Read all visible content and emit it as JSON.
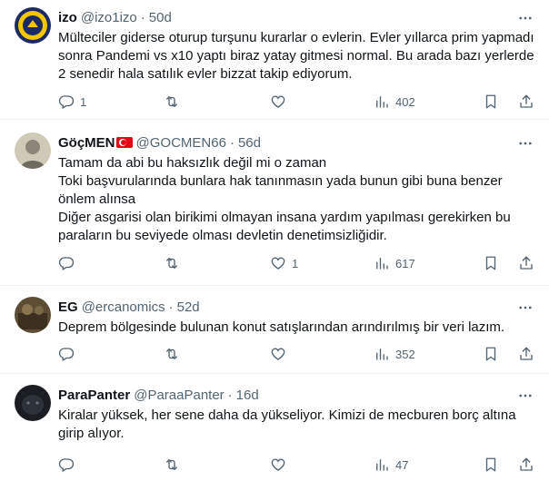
{
  "tweets": [
    {
      "name": "izo",
      "handle": "@izo1izo",
      "time": "50d",
      "lines": [
        "Mülteciler giderse oturup turşunu kurarlar o evlerin. Evler yıllarca prim yapmadı sonra Pandemi vs x10 yaptı biraz yatay gitmesi normal. Bu arada bazı yerlerde 2 senedir hala satılık evler bizzat takip ediyorum."
      ],
      "replies": "1",
      "retweets": "",
      "likes": "",
      "views": "402"
    },
    {
      "name": "GöçMEN",
      "handle": "@GOCMEN66",
      "time": "56d",
      "lines": [
        "Tamam da abi bu haksızlık değil mi o zaman",
        "Toki başvurularında bunlara hak tanınmasın yada bunun gibi buna benzer önlem alınsa",
        "Diğer asgarisi olan birikimi olmayan insana yardım yapılması gerekirken bu paraların bu seviyede olması devletin denetimsizliğidir."
      ],
      "replies": "",
      "retweets": "",
      "likes": "1",
      "views": "617"
    },
    {
      "name": "EG",
      "handle": "@ercanomics",
      "time": "52d",
      "lines": [
        "Deprem bölgesinde bulunan konut satışlarından arındırılmış bir veri lazım."
      ],
      "replies": "",
      "retweets": "",
      "likes": "",
      "views": "352"
    },
    {
      "name": "ParaPanter",
      "handle": "@ParaaPanter",
      "time": "16d",
      "lines": [
        "Kiralar yüksek, her sene daha da yükseliyor. Kimizi de mecburen borç altına girip alıyor."
      ],
      "replies": "",
      "retweets": "",
      "likes": "",
      "views": "47"
    }
  ],
  "colors": {
    "text": "#0f1419",
    "secondary": "#536471",
    "divider": "#eff3f4",
    "flag": "#e30a17"
  },
  "icons": [
    "reply-icon",
    "retweet-icon",
    "like-icon",
    "views-icon",
    "bookmark-icon",
    "share-icon",
    "more-icon"
  ]
}
